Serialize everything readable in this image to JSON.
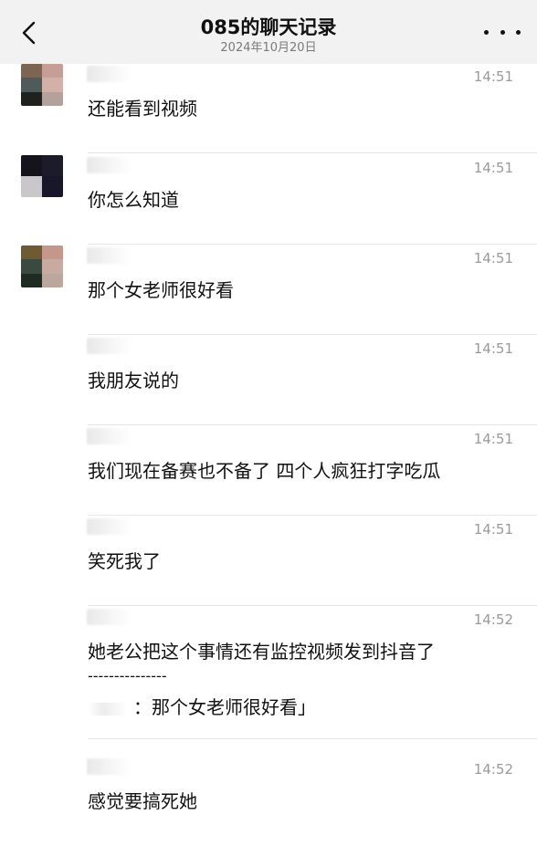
{
  "header": {
    "title": "085的聊天记录",
    "date": "2024年10月20日",
    "back_icon": "chevron-left-icon",
    "more_icon": "ellipsis-icon"
  },
  "messages": [
    {
      "time": "14:51",
      "text": "还能看到视频"
    },
    {
      "time": "14:51",
      "text": "你怎么知道"
    },
    {
      "time": "14:51",
      "text": "那个女老师很好看"
    },
    {
      "time": "14:51",
      "text": "我朋友说的"
    },
    {
      "time": "14:51",
      "text": "我们现在备赛也不备了 四个人疯狂打字吃瓜"
    },
    {
      "time": "14:51",
      "text": "笑死我了"
    },
    {
      "time": "14:52",
      "text": "她老公把这个事情还有监控视频发到抖音了",
      "quote_separator": "---------------",
      "quote_text": "：那个女老师很好看」"
    },
    {
      "time": "14:52",
      "text": "感觉要搞死她"
    }
  ],
  "colors": {
    "header_bg": "#f2f2f2",
    "time": "#9a9a9a",
    "divider": "#e6e6e6"
  }
}
